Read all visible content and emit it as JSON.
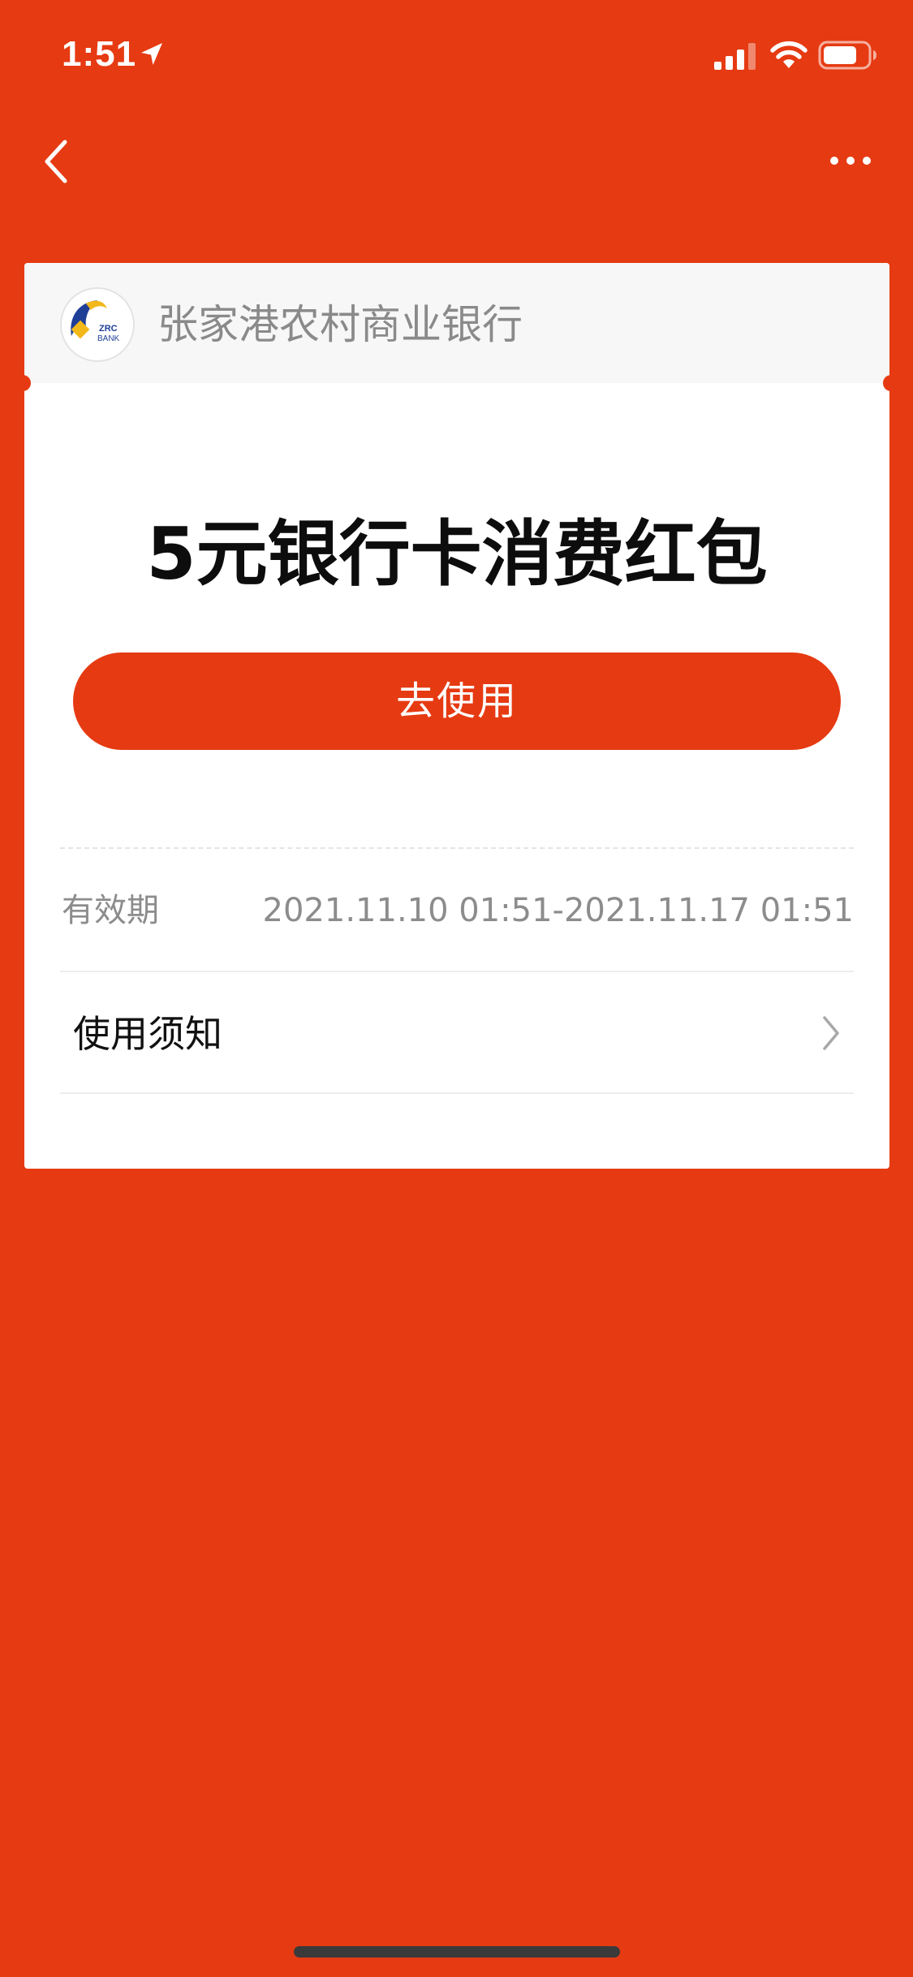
{
  "status_bar": {
    "time": "1:51",
    "location_icon": "location-arrow-icon",
    "signal_icon": "cellular-signal-icon",
    "wifi_icon": "wifi-icon",
    "battery_icon": "battery-icon"
  },
  "nav": {
    "back_icon": "chevron-left-icon",
    "more_icon": "more-dots-icon"
  },
  "card": {
    "bank": {
      "logo_text_top": "ZRC",
      "logo_text_bottom": "BANK",
      "name": "张家港农村商业银行"
    },
    "title": "5元银行卡消费红包",
    "use_button_label": "去使用",
    "validity": {
      "label": "有效期",
      "value": "2021.11.10 01:51-2021.11.17 01:51"
    },
    "notice": {
      "label": "使用须知",
      "icon": "chevron-right-icon"
    }
  },
  "colors": {
    "background": "#E63A12",
    "button": "#E63A12",
    "card": "#FFFFFF",
    "card_header": "#F7F7F7",
    "title_text": "#0D0D0D",
    "muted_text": "#8C8C8C"
  }
}
